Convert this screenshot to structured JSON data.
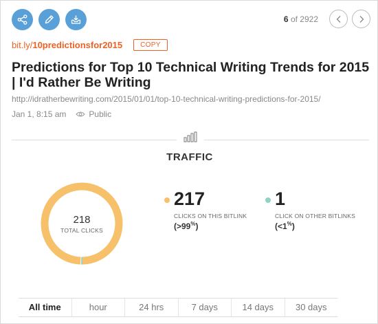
{
  "toolbar": {
    "icons": [
      "share-icon",
      "edit-icon",
      "inbox-icon"
    ],
    "accent": "#5aa0d8"
  },
  "pager": {
    "current": "6",
    "of_text": "of 2922"
  },
  "link": {
    "domain": "bit.ly/",
    "path": "10predictionsfor2015",
    "copy_label": "COPY",
    "accent": "#ee6123"
  },
  "title": "Predictions for Top 10 Technical Writing Trends for 2015 | I'd Rather Be Writing",
  "long_url": "http://idratherbewriting.com/2015/01/01/top-10-technical-writing-predictions-for-2015/",
  "meta": {
    "date": "Jan 1, 8:15 am",
    "visibility": "Public"
  },
  "traffic": {
    "heading": "TRAFFIC",
    "total": "218",
    "total_label": "TOTAL CLICKS",
    "this": {
      "count": "217",
      "label": "CLICKS ON THIS BITLINK",
      "pct_open": "(>99",
      "pct_sup": "%",
      "pct_close": ")",
      "color": "#f7c06a"
    },
    "other": {
      "count": "1",
      "label": "CLICK ON OTHER BITLINKS",
      "pct_open": "(<1",
      "pct_sup": "%",
      "pct_close": ")",
      "color": "#8fd3c6"
    },
    "donut_share_this": 0.995
  },
  "tabs": [
    "All time",
    "hour",
    "24 hrs",
    "7 days",
    "14 days",
    "30 days"
  ],
  "active_tab": 0
}
